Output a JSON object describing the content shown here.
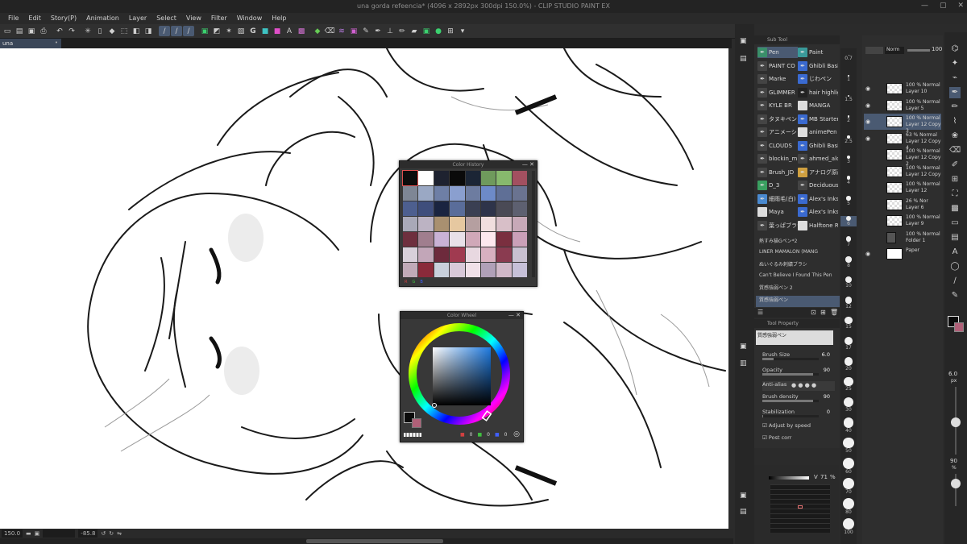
{
  "window": {
    "title": "una gorda refeencia* (4096 x 2892px 300dpi 150.0%) - CLIP STUDIO PAINT EX"
  },
  "menu": [
    "File",
    "Edit",
    "Story(P)",
    "Animation",
    "Layer",
    "Select",
    "View",
    "Filter",
    "Window",
    "Help"
  ],
  "document_tab": {
    "label": "una"
  },
  "status": {
    "zoom": "150.0",
    "angle": "-85.8"
  },
  "color_history": {
    "title": "Color History",
    "swatches": [
      "#0d0d0d",
      "#ffffff",
      "#1e2230",
      "#0a0a0a",
      "#1b2535",
      "#6f9a5c",
      "#87b96d",
      "#a25060",
      "#7e8695",
      "#9aa8c4",
      "#6e7fa6",
      "#8a9fcf",
      "#6d7ca0",
      "#6d8ac8",
      "#5f6f96",
      "#6a7390",
      "#4d5f8f",
      "#3f4e7c",
      "#1a2440",
      "#5a6d9a",
      "#3a3f52",
      "#2e344a",
      "#4a4a55",
      "#5d6070",
      "#a9a9b8",
      "#bcb3c3",
      "#a99070",
      "#e6c8a0",
      "#b59fa0",
      "#f0dede",
      "#d8bfc8",
      "#c7a9b8",
      "#6e2f3e",
      "#a07e8e",
      "#c9b2d6",
      "#e8e0e8",
      "#d0a8b8",
      "#fde8ee",
      "#7a2f3f",
      "#caa0b8",
      "#d8d0da",
      "#c2a6b8",
      "#6d2a3c",
      "#a03a50",
      "#e8d8e0",
      "#d8b0c0",
      "#8a3b50",
      "#c8c0d0",
      "#c0aab8",
      "#8a2a3a",
      "#c9d0dc",
      "#d8c8d8",
      "#f0e0e8",
      "#b0a0b8",
      "#d0b8c8",
      "#c6c0d8"
    ],
    "foot": [
      "R",
      "G",
      "B"
    ]
  },
  "color_wheel": {
    "title": "Color Wheel",
    "rgb": [
      "0",
      "0",
      "0"
    ]
  },
  "sub_tool": {
    "title": "Sub Tool",
    "left_col": [
      "Pen",
      "PAINT CO",
      "Marke",
      "GLIMMER",
      "KYLE BR",
      "タヌキペン 2",
      "アニメーショ",
      "CLOUDS",
      "blockin_m",
      "Brush_JD",
      "D_3",
      "細雨毛(白)",
      "Maya",
      "葉っぱブラシ"
    ],
    "right_col": [
      "Paint",
      "Ghibli Basi",
      "じわペン",
      "hair highlig",
      "MANGA",
      "MB Starter",
      "animePen",
      "Ghibli Basi",
      "ahmed_alo",
      "アナログ原画",
      "Deciduous",
      "Alex's Inks",
      "Alex's Inks",
      "Halftone R"
    ],
    "brushes": [
      "熱すみ猫Gペン*2",
      "LINER MAMALON (MANG",
      "ぬいぐるみ刺繍ブラシ",
      "Can't Believe I Found This Pen",
      "質感強弱ペン 2",
      "質感強弱ペン"
    ]
  },
  "tool_property": {
    "title": "Tool Property",
    "brush_name": "質感強弱ペン",
    "brush_size_label": "Brush Size",
    "brush_size_value": "6.0",
    "opacity_label": "Opacity",
    "opacity_value": "90",
    "antialias_label": "Anti-alias",
    "brush_density_label": "Brush density",
    "brush_density_value": "90",
    "stabilization_label": "Stabilization",
    "stabilization_value": "0",
    "adjust_speed_label": "Adjust by speed",
    "post_correction_label": "Post corr"
  },
  "brush_sizes": [
    "0.7",
    "1",
    "1.5",
    "2",
    "2.5",
    "3",
    "4",
    "5",
    "6",
    "7",
    "8",
    "10",
    "12",
    "15",
    "17",
    "20",
    "25",
    "30",
    "40",
    "50",
    "60",
    "70",
    "80",
    "100"
  ],
  "navigator": {
    "v_label": "V",
    "v_value": "71",
    "v_unit": "%"
  },
  "layers": {
    "blend_mode": "Norm",
    "opacity": "100",
    "items": [
      {
        "opacity": "100 %",
        "mode": "Normal",
        "name": "Layer 10"
      },
      {
        "opacity": "100 %",
        "mode": "Normal",
        "name": "Layer 5"
      },
      {
        "opacity": "100 %",
        "mode": "Normal",
        "name": "Layer 12 Copy 3"
      },
      {
        "opacity": "63 %",
        "mode": "Normal",
        "name": "Layer 12 Copy 4"
      },
      {
        "opacity": "100 %",
        "mode": "Normal",
        "name": "Layer 12 Copy 2"
      },
      {
        "opacity": "100 %",
        "mode": "Normal",
        "name": "Layer 12 Copy"
      },
      {
        "opacity": "100 %",
        "mode": "Normal",
        "name": "Layer 12"
      },
      {
        "opacity": "26 %",
        "mode": "Nor",
        "name": "Layer 6"
      },
      {
        "opacity": "100 %",
        "mode": "Normal",
        "name": "Layer 9"
      },
      {
        "opacity": "100 %",
        "mode": "Normal",
        "name": "Folder 1"
      },
      {
        "opacity": "",
        "mode": "",
        "name": "Paper"
      }
    ]
  },
  "right_toolbar": {
    "size_value": "6.0",
    "size_unit": "px",
    "opacity_value": "90",
    "opacity_unit": "%"
  }
}
